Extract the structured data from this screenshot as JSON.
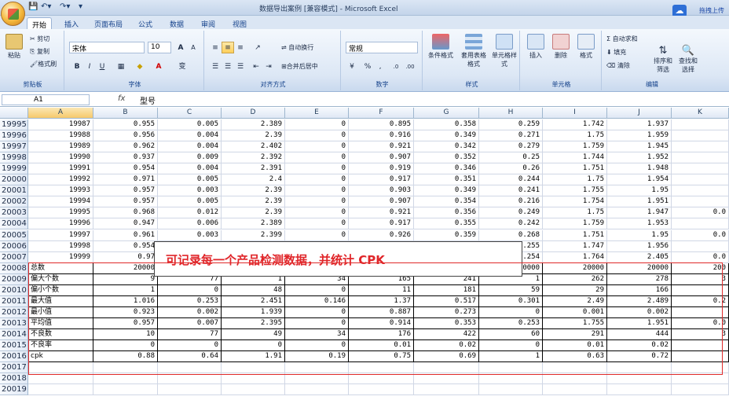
{
  "titlebar": {
    "title": "数据导出案例 [兼容模式] - Microsoft Excel",
    "upload": "拖拽上传",
    "upload_icon": "cloud-upload-icon"
  },
  "tabs": [
    "开始",
    "插入",
    "页面布局",
    "公式",
    "数据",
    "审阅",
    "视图"
  ],
  "ribbon": {
    "clipboard": {
      "paste": "粘贴",
      "cut": "剪切",
      "copy": "复制",
      "format_painter": "格式刷",
      "label": "剪贴板"
    },
    "font": {
      "name": "宋体",
      "size": "10",
      "bold": "B",
      "italic": "I",
      "underline": "U",
      "grow": "A",
      "shrink": "A",
      "label": "字体",
      "wen": "变"
    },
    "align": {
      "wrap": "自动换行",
      "merge": "合并后居中",
      "label": "对齐方式"
    },
    "number": {
      "format": "常规",
      "percent": "%",
      "comma": ",",
      "label": "数字"
    },
    "styles": {
      "cond": "条件格式",
      "table": "套用表格格式",
      "cell": "单元格样式",
      "label": "样式"
    },
    "cells": {
      "insert": "插入",
      "delete": "删除",
      "format": "格式",
      "label": "单元格"
    },
    "edit": {
      "autosum": "自动求和",
      "fill": "填充",
      "clear": "清除",
      "sort": "排序和筛选",
      "find": "查找和选择",
      "label": "编辑"
    }
  },
  "formula_bar": {
    "name_box": "A1",
    "fx": "fx",
    "value": "型号"
  },
  "columns": [
    "A",
    "B",
    "C",
    "D",
    "E",
    "F",
    "G",
    "H",
    "I",
    "J",
    "K"
  ],
  "rows": [
    {
      "n": "19995",
      "c": [
        "19987",
        "0.955",
        "0.005",
        "2.389",
        "0",
        "0.895",
        "0.358",
        "0.259",
        "1.742",
        "1.937",
        ""
      ]
    },
    {
      "n": "19996",
      "c": [
        "19988",
        "0.956",
        "0.004",
        "2.39",
        "0",
        "0.916",
        "0.349",
        "0.271",
        "1.75",
        "1.959",
        ""
      ]
    },
    {
      "n": "19997",
      "c": [
        "19989",
        "0.962",
        "0.004",
        "2.402",
        "0",
        "0.921",
        "0.342",
        "0.279",
        "1.759",
        "1.945",
        ""
      ]
    },
    {
      "n": "19998",
      "c": [
        "19990",
        "0.937",
        "0.009",
        "2.392",
        "0",
        "0.907",
        "0.352",
        "0.25",
        "1.744",
        "1.952",
        ""
      ]
    },
    {
      "n": "19999",
      "c": [
        "19991",
        "0.954",
        "0.004",
        "2.391",
        "0",
        "0.919",
        "0.346",
        "0.26",
        "1.751",
        "1.948",
        ""
      ]
    },
    {
      "n": "20000",
      "c": [
        "19992",
        "0.971",
        "0.005",
        "2.4",
        "0",
        "0.917",
        "0.351",
        "0.244",
        "1.75",
        "1.954",
        ""
      ]
    },
    {
      "n": "20001",
      "c": [
        "19993",
        "0.957",
        "0.003",
        "2.39",
        "0",
        "0.903",
        "0.349",
        "0.241",
        "1.755",
        "1.95",
        ""
      ]
    },
    {
      "n": "20002",
      "c": [
        "19994",
        "0.957",
        "0.005",
        "2.39",
        "0",
        "0.907",
        "0.354",
        "0.216",
        "1.754",
        "1.951",
        ""
      ]
    },
    {
      "n": "20003",
      "c": [
        "19995",
        "0.968",
        "0.012",
        "2.39",
        "0",
        "0.921",
        "0.356",
        "0.249",
        "1.75",
        "1.947",
        "0.0"
      ]
    },
    {
      "n": "20004",
      "c": [
        "19996",
        "0.947",
        "0.006",
        "2.389",
        "0",
        "0.917",
        "0.355",
        "0.242",
        "1.759",
        "1.953",
        ""
      ]
    },
    {
      "n": "20005",
      "c": [
        "19997",
        "0.961",
        "0.003",
        "2.399",
        "0",
        "0.926",
        "0.359",
        "0.268",
        "1.751",
        "1.95",
        "0.0"
      ]
    },
    {
      "n": "20006",
      "c": [
        "19998",
        "0.954",
        "",
        "",
        "",
        "",
        "",
        "0.255",
        "1.747",
        "1.956",
        ""
      ]
    },
    {
      "n": "20007",
      "c": [
        "19999",
        "0.97",
        "",
        "",
        "",
        "",
        "",
        "0.254",
        "1.764",
        "2.405",
        "0.0"
      ]
    },
    {
      "n": "20008",
      "c": [
        "总数",
        "20000",
        "",
        "",
        "",
        "",
        "",
        "20000",
        "20000",
        "20000",
        "200"
      ]
    },
    {
      "n": "20009",
      "c": [
        "偏大个数",
        "9",
        "77",
        "1",
        "34",
        "165",
        "241",
        "1",
        "262",
        "278",
        "3"
      ]
    },
    {
      "n": "20010",
      "c": [
        "偏小个数",
        "1",
        "0",
        "48",
        "0",
        "11",
        "181",
        "59",
        "29",
        "166",
        ""
      ]
    },
    {
      "n": "20011",
      "c": [
        "最大值",
        "1.016",
        "0.253",
        "2.451",
        "0.146",
        "1.37",
        "0.517",
        "0.301",
        "2.49",
        "2.489",
        "0.2"
      ]
    },
    {
      "n": "20012",
      "c": [
        "最小值",
        "0.923",
        "0.002",
        "1.939",
        "0",
        "0.887",
        "0.273",
        "0",
        "0.001",
        "0.002",
        ""
      ]
    },
    {
      "n": "20013",
      "c": [
        "平均值",
        "0.957",
        "0.007",
        "2.395",
        "0",
        "0.914",
        "0.353",
        "0.253",
        "1.755",
        "1.951",
        "0.0"
      ]
    },
    {
      "n": "20014",
      "c": [
        "不良数",
        "10",
        "77",
        "49",
        "34",
        "176",
        "422",
        "60",
        "291",
        "444",
        "3"
      ]
    },
    {
      "n": "20015",
      "c": [
        "不良率",
        "0",
        "0",
        "0",
        "0",
        "0.01",
        "0.02",
        "0",
        "0.01",
        "0.02",
        ""
      ]
    },
    {
      "n": "20016",
      "c": [
        "cpk",
        "0.88",
        "0.64",
        "1.91",
        "0.19",
        "0.75",
        "0.69",
        "1",
        "0.63",
        "0.72",
        ""
      ]
    },
    {
      "n": "20017",
      "c": [
        "",
        "",
        "",
        "",
        "",
        "",
        "",
        "",
        "",
        "",
        ""
      ]
    },
    {
      "n": "20018",
      "c": [
        "",
        "",
        "",
        "",
        "",
        "",
        "",
        "",
        "",
        "",
        ""
      ]
    },
    {
      "n": "20019",
      "c": [
        "",
        "",
        "",
        "",
        "",
        "",
        "",
        "",
        "",
        "",
        ""
      ]
    }
  ],
  "callout": "可记录每一个产品检测数据，并统计 CPK",
  "colors": {
    "accent": "#e02a2a",
    "ribbon": "#dce7f5"
  }
}
